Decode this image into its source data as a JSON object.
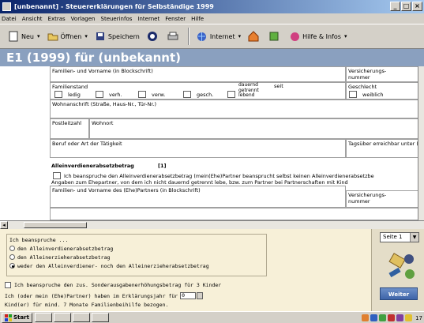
{
  "window": {
    "title": "[unbenannt] - Steuererklärungen für Selbständige 1999"
  },
  "menu": [
    "Datei",
    "Ansicht",
    "Extras",
    "Vorlagen",
    "Steuerinfos",
    "Internet",
    "Fenster",
    "Hilfe"
  ],
  "toolbar": {
    "new": "Neu",
    "open": "Öffnen",
    "save": "Speichern",
    "internet": "Internet",
    "help": "Hilfe & Infos"
  },
  "form_header": "E1 (1999) für (unbekannt)",
  "form": {
    "name_label": "Familien- und Vorname (in Blockschrift)",
    "insurance_label": "Versicherungs-\nnummer",
    "family_status_label": "Familienstand",
    "ledig": "ledig",
    "verh": "verh.",
    "verw": "verw.",
    "gesch": "gesch.",
    "dauernd_getrennt": "dauernd\ngetrennt\nlebend",
    "seit": "seit",
    "gender_label": "Geschlecht",
    "weiblich": "weiblich",
    "address_label": "Wohnanschrift (Straße, Haus-Nr., Tür-Nr.)",
    "zip_label": "Postleitzahl",
    "city_label": "Wohnort",
    "occupation_label": "Beruf oder Art der Tätigkeit",
    "daytime_label": "Tagsüber erreichbar unter (",
    "section_title": "Alleinverdienerabsetzbetrag",
    "section_ref": "[1]",
    "section_text1": "Ich beanspruche den Alleinverdienerabsetzbetrag (mein(Ehe)Partner beansprucht selbst keinen Alleinverdienerabsetzbe",
    "section_text2": "Angaben zum Ehepartner, von dem ich nicht dauernd getrennt lebe, bzw. zum Partner bei Partnerschaften mit Kind",
    "partner_name_label": "Familien- und Vorname des (Ehe)Partners (in Blockschrift)",
    "partner_insurance_label": "Versicherungs-\nnummer"
  },
  "panel": {
    "group_title": "Ich beanspruche ...",
    "options": [
      "den Alleinverdienerabsetzbetrag",
      "den Alleinerzieherabsetzbetrag",
      "weder den Alleinverdiener- noch den Alleinerzieherabsetzbetrag"
    ],
    "selected_option": 2,
    "checkbox_label": "Ich beanspruche den zus. Sonderausgabenerhöhungsbetrag für 3 Kinder",
    "question_line1": "Ich (oder mein (Ehe)Partner) haben im Erklärungsjahr für",
    "question_line2": "Kind(er) für mind. 7 Monate Familienbeihilfe bezogen.",
    "children_value": "0",
    "page_select": "Seite 1",
    "weiter": "Weiter"
  },
  "taskbar": {
    "start": "Start",
    "clock": "17"
  }
}
